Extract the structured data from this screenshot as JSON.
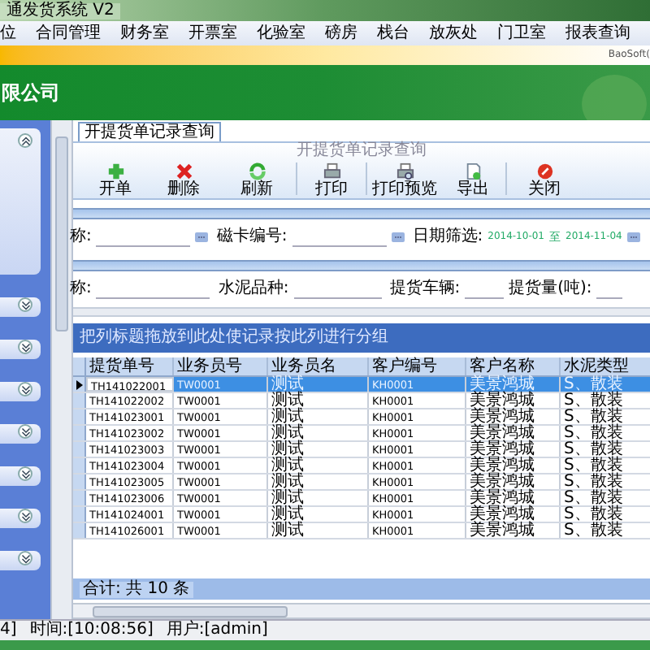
{
  "window": {
    "title": "通发货系统 V2"
  },
  "menu": [
    "位",
    "合同管理",
    "财务室",
    "开票室",
    "化验室",
    "磅房",
    "栈台",
    "放灰处",
    "门卫室",
    "报表查询"
  ],
  "brand_strip": {
    "text": "BaoSoft("
  },
  "banner": {
    "company": "限公司"
  },
  "sidebar": {
    "sections": [
      {
        "expanded": true
      },
      {
        "expanded": false
      },
      {
        "expanded": false
      },
      {
        "expanded": false
      },
      {
        "expanded": false
      },
      {
        "expanded": false
      },
      {
        "expanded": false
      },
      {
        "expanded": false
      }
    ]
  },
  "tabs": [
    {
      "label": "开提货单记录查询",
      "selected": true
    }
  ],
  "toolbar": {
    "caption": "开提货单记录查询",
    "buttons": [
      {
        "kind": "add",
        "label": "开单"
      },
      {
        "kind": "delete",
        "label": "删除"
      },
      {
        "kind": "refresh",
        "label": "刷新"
      },
      {
        "kind": "print",
        "label": "打印"
      },
      {
        "kind": "preview",
        "label": "打印预览"
      },
      {
        "kind": "export",
        "label": "导出"
      },
      {
        "kind": "close",
        "label": "关闭"
      }
    ]
  },
  "filters": {
    "row_1": {
      "label_1": "称:",
      "label_2": "磁卡编号:",
      "label_3": "日期筛选:",
      "date_from": "2014-10-01",
      "to": "至",
      "date_to": "2014-11-04"
    },
    "row_2": {
      "label_1": "称:",
      "label_2": "水泥品种:",
      "label_3": "提货车辆:",
      "label_4": "提货量(吨):"
    }
  },
  "grid": {
    "group_hint": "把列标题拖放到此处使记录按此列进行分组",
    "columns": [
      "提货单号",
      "业务员号",
      "业务员名",
      "客户编号",
      "客户名称",
      "水泥类型"
    ],
    "rows": [
      {
        "selected": true,
        "cells": [
          "TH141022001",
          "TW0001",
          "测试",
          "KH0001",
          "美景鸿城",
          "S、散装"
        ]
      },
      {
        "selected": false,
        "cells": [
          "TH141022002",
          "TW0001",
          "测试",
          "KH0001",
          "美景鸿城",
          "S、散装"
        ]
      },
      {
        "selected": false,
        "cells": [
          "TH141023001",
          "TW0001",
          "测试",
          "KH0001",
          "美景鸿城",
          "S、散装"
        ]
      },
      {
        "selected": false,
        "cells": [
          "TH141023002",
          "TW0001",
          "测试",
          "KH0001",
          "美景鸿城",
          "S、散装"
        ]
      },
      {
        "selected": false,
        "cells": [
          "TH141023003",
          "TW0001",
          "测试",
          "KH0001",
          "美景鸿城",
          "S、散装"
        ]
      },
      {
        "selected": false,
        "cells": [
          "TH141023004",
          "TW0001",
          "测试",
          "KH0001",
          "美景鸿城",
          "S、散装"
        ]
      },
      {
        "selected": false,
        "cells": [
          "TH141023005",
          "TW0001",
          "测试",
          "KH0001",
          "美景鸿城",
          "S、散装"
        ]
      },
      {
        "selected": false,
        "cells": [
          "TH141023006",
          "TW0001",
          "测试",
          "KH0001",
          "美景鸿城",
          "S、散装"
        ]
      },
      {
        "selected": false,
        "cells": [
          "TH141024001",
          "TW0001",
          "测试",
          "KH0001",
          "美景鸿城",
          "S、散装"
        ]
      },
      {
        "selected": false,
        "cells": [
          "TH141026001",
          "TW0001",
          "测试",
          "KH0001",
          "美景鸿城",
          "S、散装"
        ]
      }
    ],
    "footer": "合计: 共 10 条"
  },
  "status_bar": [
    "4]",
    "时间:[10:08:56]",
    "用户:[admin]"
  ]
}
